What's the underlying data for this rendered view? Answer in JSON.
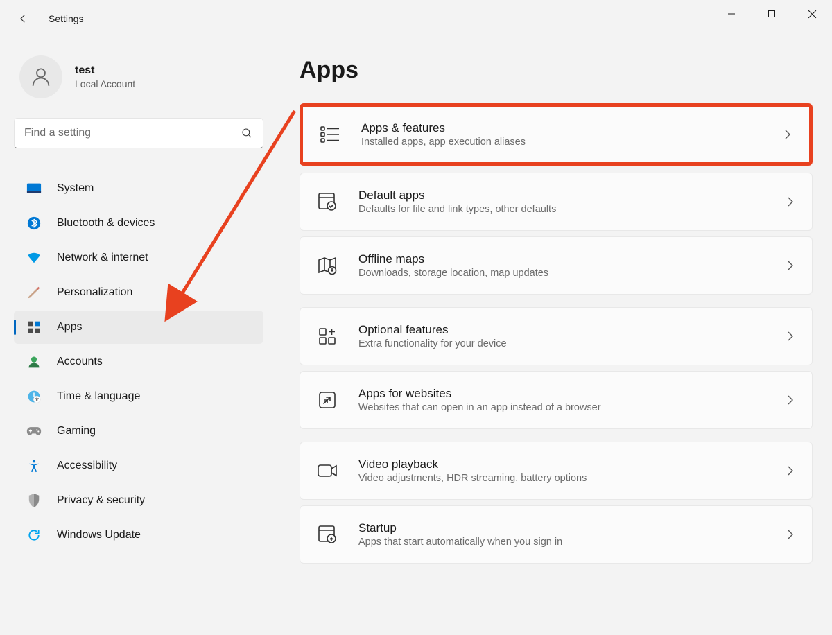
{
  "window": {
    "title": "Settings"
  },
  "user": {
    "name": "test",
    "subtitle": "Local Account"
  },
  "search": {
    "placeholder": "Find a setting"
  },
  "sidebar": {
    "items": [
      {
        "label": "System"
      },
      {
        "label": "Bluetooth & devices"
      },
      {
        "label": "Network & internet"
      },
      {
        "label": "Personalization"
      },
      {
        "label": "Apps"
      },
      {
        "label": "Accounts"
      },
      {
        "label": "Time & language"
      },
      {
        "label": "Gaming"
      },
      {
        "label": "Accessibility"
      },
      {
        "label": "Privacy & security"
      },
      {
        "label": "Windows Update"
      }
    ],
    "active_index": 4
  },
  "page": {
    "title": "Apps",
    "cards": [
      {
        "title": "Apps & features",
        "subtitle": "Installed apps, app execution aliases",
        "highlighted": true
      },
      {
        "title": "Default apps",
        "subtitle": "Defaults for file and link types, other defaults"
      },
      {
        "title": "Offline maps",
        "subtitle": "Downloads, storage location, map updates"
      },
      {
        "title": "Optional features",
        "subtitle": "Extra functionality for your device"
      },
      {
        "title": "Apps for websites",
        "subtitle": "Websites that can open in an app instead of a browser"
      },
      {
        "title": "Video playback",
        "subtitle": "Video adjustments, HDR streaming, battery options"
      },
      {
        "title": "Startup",
        "subtitle": "Apps that start automatically when you sign in"
      }
    ]
  },
  "annotation": {
    "color": "#e8411f"
  }
}
